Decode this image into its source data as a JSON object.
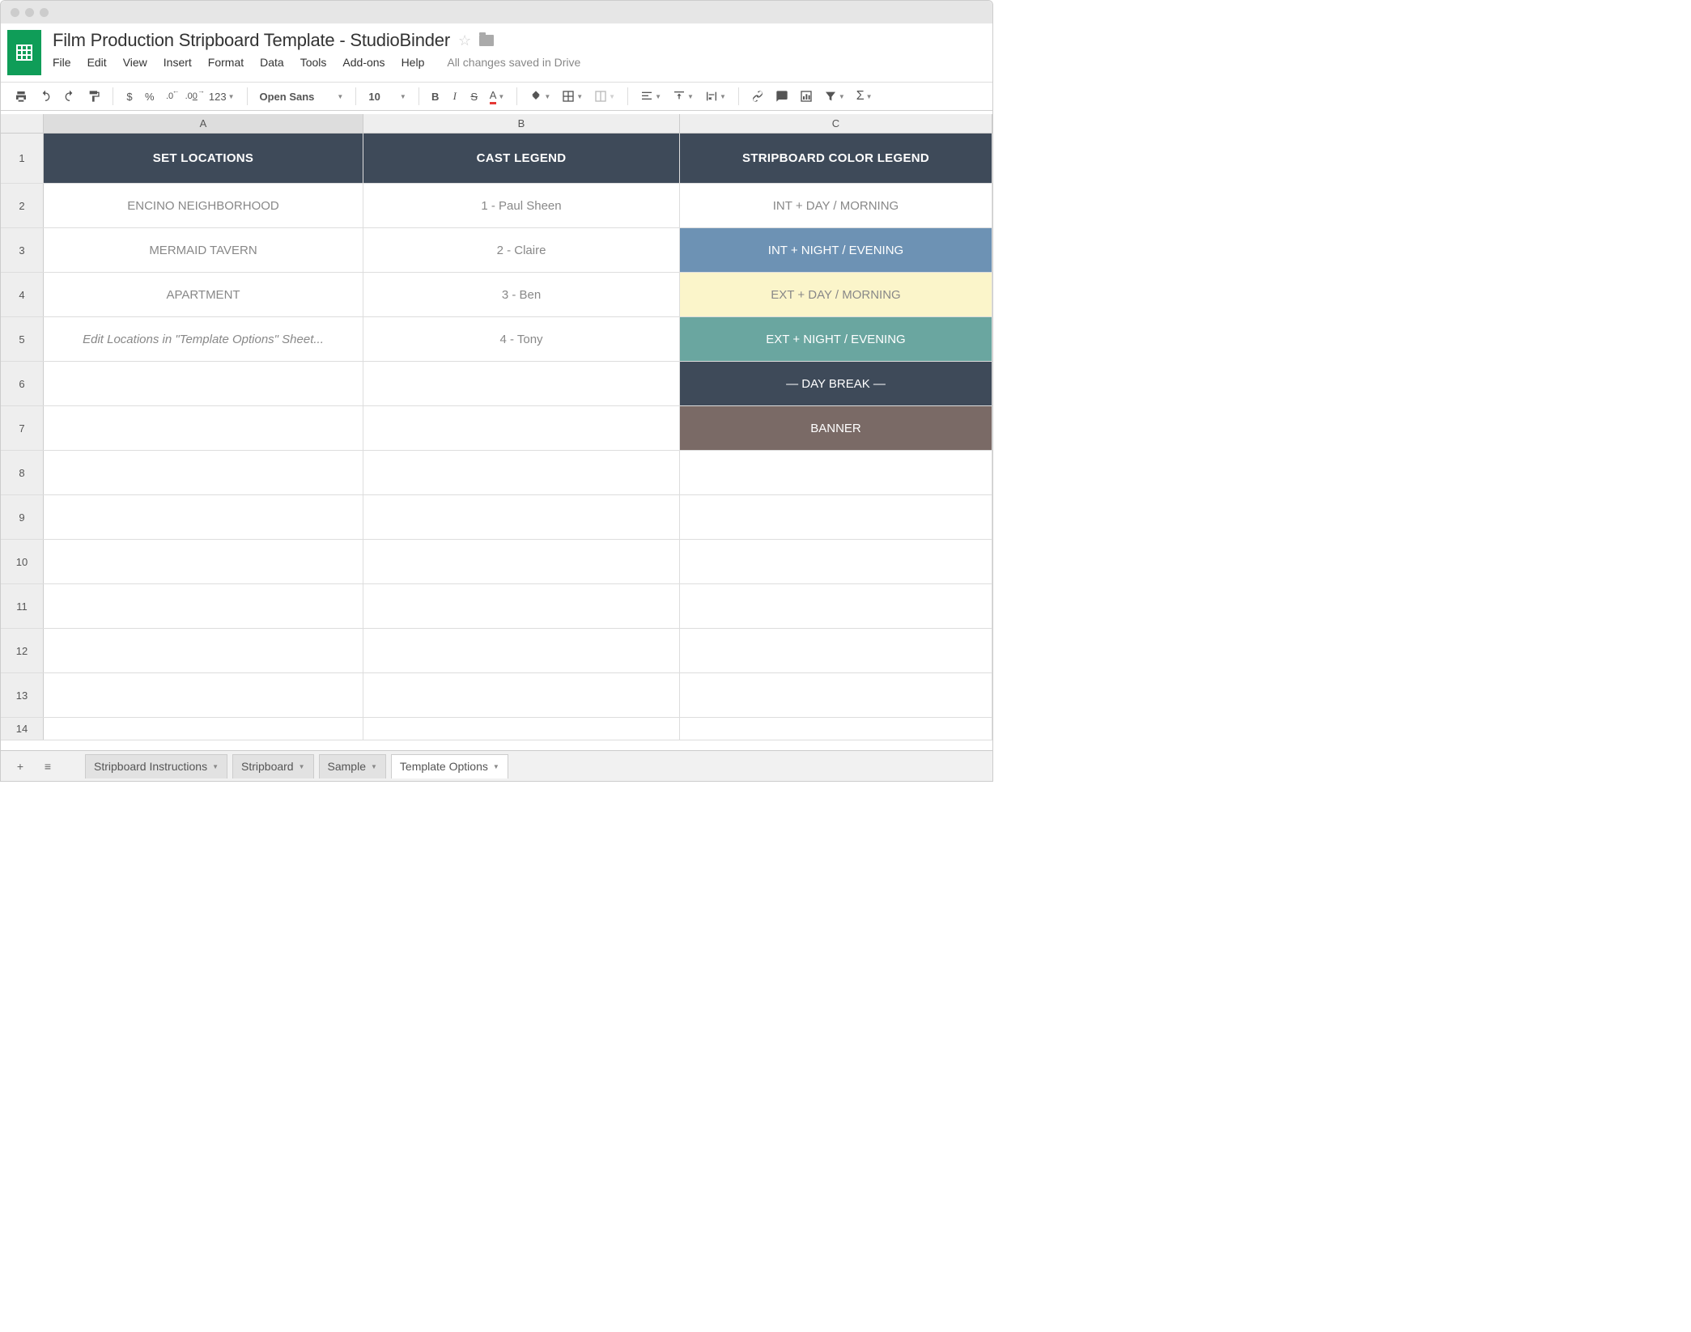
{
  "window": {
    "title": "Film Production Stripboard Template  -  StudioBinder"
  },
  "menus": {
    "file": "File",
    "edit": "Edit",
    "view": "View",
    "insert": "Insert",
    "format": "Format",
    "data": "Data",
    "tools": "Tools",
    "addons": "Add-ons",
    "help": "Help"
  },
  "save_status": "All changes saved in Drive",
  "toolbar": {
    "currency": "$",
    "percent": "%",
    "dec_dec": ".0",
    "inc_dec": ".00",
    "num123": "123",
    "font": "Open Sans",
    "size": "10",
    "bold": "B",
    "italic": "I",
    "strike": "S",
    "textcolor": "A",
    "sigma": "Σ"
  },
  "columns": {
    "A": "A",
    "B": "B",
    "C": "C"
  },
  "row_numbers": [
    "1",
    "2",
    "3",
    "4",
    "5",
    "6",
    "7",
    "8",
    "9",
    "10",
    "11",
    "12",
    "13",
    "14"
  ],
  "header_row": {
    "A": "SET LOCATIONS",
    "B": "CAST LEGEND",
    "C": "STRIPBOARD COLOR LEGEND"
  },
  "cells": {
    "A2": "ENCINO NEIGHBORHOOD",
    "B2": "1 - Paul Sheen",
    "C2": "INT  +  DAY / MORNING",
    "A3": "MERMAID TAVERN",
    "B3": "2 - Claire",
    "C3": "INT  +  NIGHT / EVENING",
    "A4": "APARTMENT",
    "B4": "3 - Ben",
    "C4": "EXT  +  DAY / MORNING",
    "A5_hint": "Edit Locations in \"Template Options\" Sheet...",
    "B5": "4 - Tony",
    "C5": "EXT  +  NIGHT / EVENING",
    "C6": "— DAY BREAK —",
    "C7": "BANNER"
  },
  "legend_colors": {
    "C2": "#ffffff",
    "C3": "#6d92b4",
    "C4": "#fbf5ca",
    "C5": "#6aa6a0",
    "C6": "#3e4a59",
    "C7": "#7a6a66"
  },
  "tabs": {
    "add": "+",
    "all": "≡",
    "items": [
      {
        "label": "Stripboard Instructions",
        "active": false
      },
      {
        "label": "Stripboard",
        "active": false
      },
      {
        "label": "Sample",
        "active": false
      },
      {
        "label": "Template Options",
        "active": true
      }
    ]
  }
}
